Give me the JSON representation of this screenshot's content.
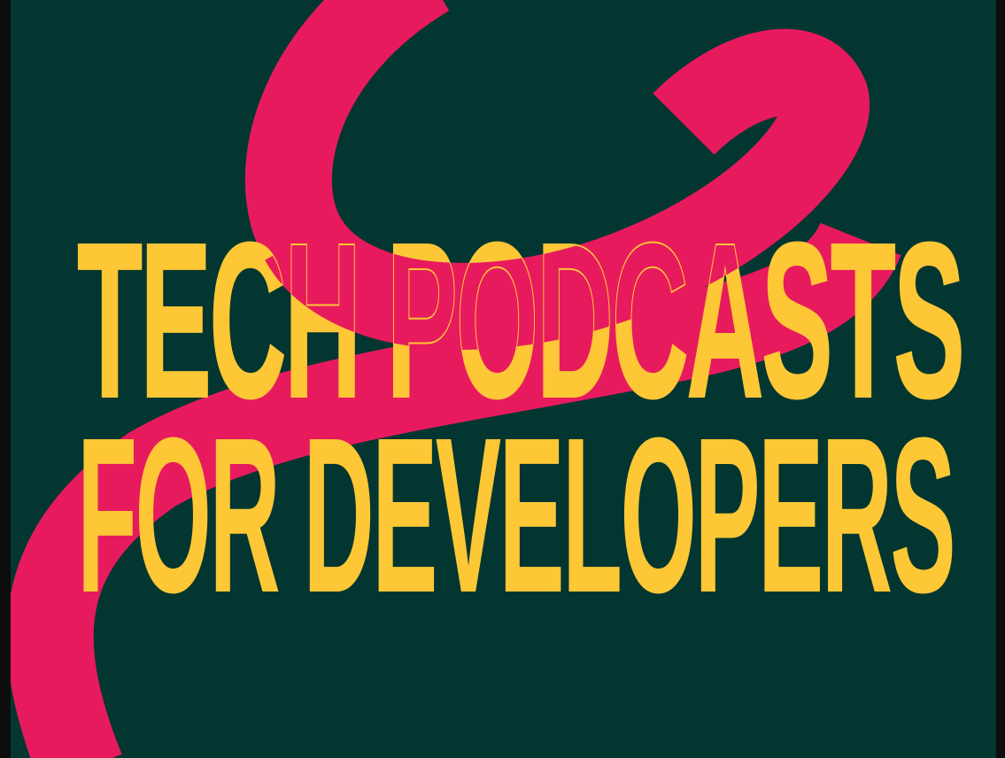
{
  "cover": {
    "title_line_1": "TECH PODCASTS",
    "title_line_2": "FOR DEVELOPERS"
  },
  "colors": {
    "background": "#033630",
    "frame": "#0d0d0d",
    "ribbon": "#E81A5E",
    "headline": "#FDC736"
  }
}
